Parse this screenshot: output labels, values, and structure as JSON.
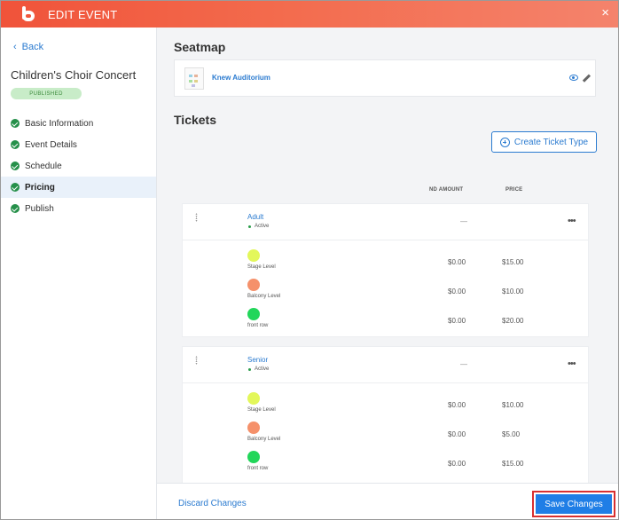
{
  "header": {
    "title": "EDIT EVENT",
    "close": "×"
  },
  "sidebar": {
    "back": "Back",
    "event_name": "Children's Choir Concert",
    "status_badge": "PUBLISHED",
    "items": [
      {
        "label": "Basic Information"
      },
      {
        "label": "Event Details"
      },
      {
        "label": "Schedule"
      },
      {
        "label": "Pricing"
      },
      {
        "label": "Publish"
      }
    ],
    "active_item": "Pricing"
  },
  "seatmap": {
    "heading": "Seatmap",
    "name": "Knew Auditorium"
  },
  "tickets": {
    "heading": "Tickets",
    "create_label": "Create Ticket Type",
    "columns": {
      "amount": "ND AMOUNT",
      "price": "PRICE"
    },
    "types": [
      {
        "name": "Adult",
        "status": "Active",
        "amount": "—",
        "levels": [
          {
            "label": "Stage Level",
            "color": "#e3f75a",
            "amount": "$0.00",
            "price": "$15.00"
          },
          {
            "label": "Balcony Level",
            "color": "#f5916b",
            "amount": "$0.00",
            "price": "$10.00"
          },
          {
            "label": "front row",
            "color": "#22d65a",
            "amount": "$0.00",
            "price": "$20.00"
          }
        ]
      },
      {
        "name": "Senior",
        "status": "Active",
        "amount": "—",
        "levels": [
          {
            "label": "Stage Level",
            "color": "#e3f75a",
            "amount": "$0.00",
            "price": "$10.00"
          },
          {
            "label": "Balcony Level",
            "color": "#f5916b",
            "amount": "$0.00",
            "price": "$5.00"
          },
          {
            "label": "front row",
            "color": "#22d65a",
            "amount": "$0.00",
            "price": "$15.00"
          }
        ]
      }
    ]
  },
  "footer": {
    "discard": "Discard Changes",
    "save": "Save Changes"
  },
  "colors": {
    "accent": "#2b7bd0",
    "header_start": "#f0533a",
    "header_end": "#f4836c",
    "save": "#1f7ee6",
    "highlight_border": "#d83030"
  }
}
